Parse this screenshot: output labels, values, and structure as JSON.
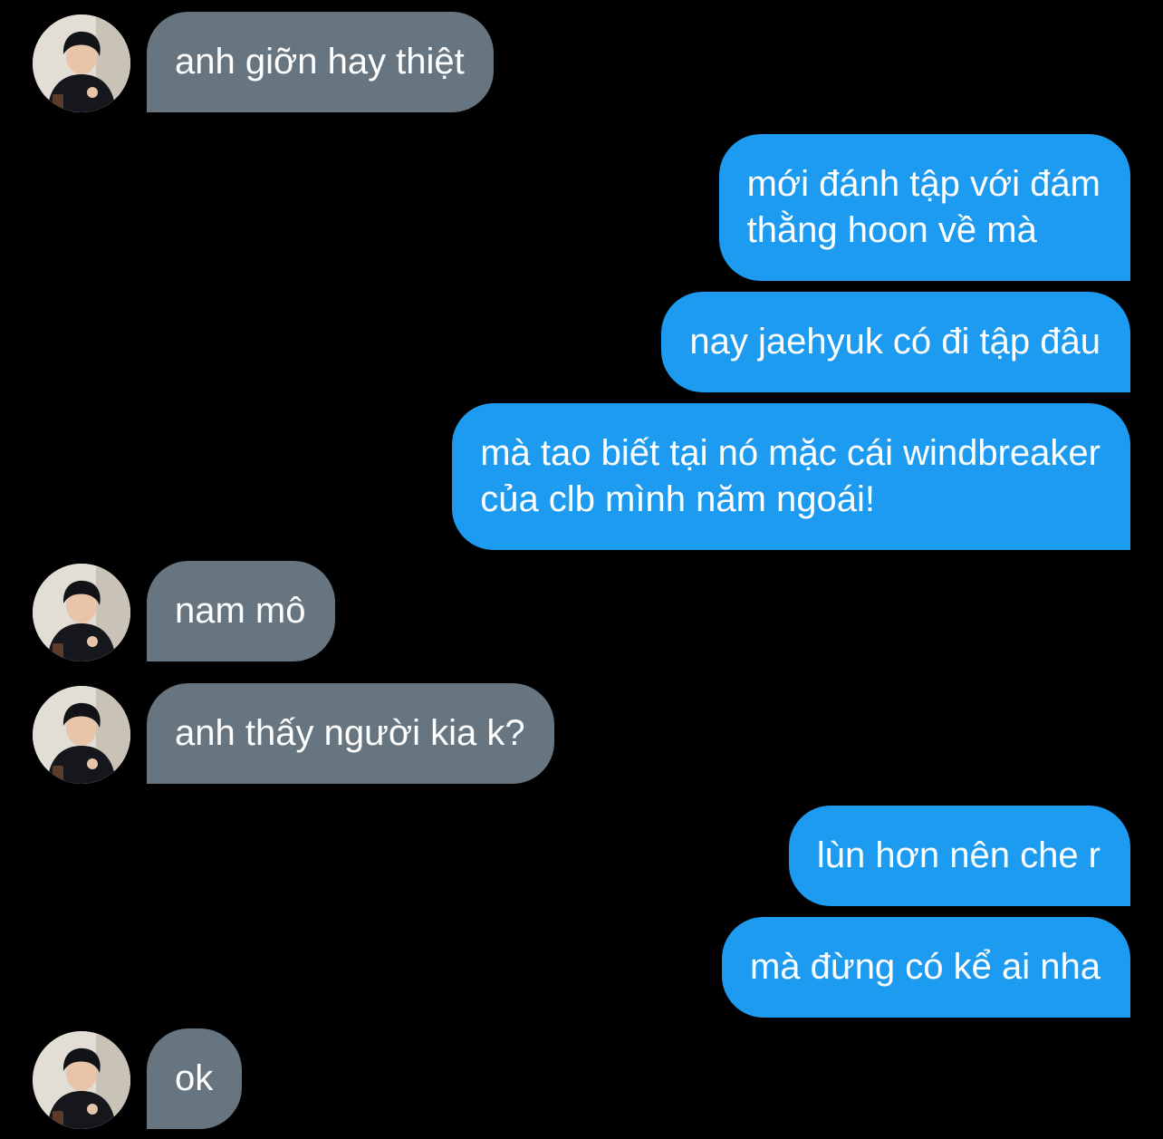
{
  "colors": {
    "background": "#000000",
    "incoming_bubble": "#66757f",
    "outgoing_bubble": "#1d9bf0",
    "text": "#ffffff"
  },
  "avatar": {
    "icon": "profile-photo-avatar"
  },
  "messages": [
    {
      "side": "incoming",
      "lines": [
        "anh giỡn hay thiệt"
      ]
    },
    {
      "side": "outgoing",
      "lines": [
        "mới đánh tập với đám",
        "thằng hoon về mà"
      ]
    },
    {
      "side": "outgoing",
      "lines": [
        "nay jaehyuk có đi tập đâu"
      ]
    },
    {
      "side": "outgoing",
      "lines": [
        "mà tao biết tại nó mặc cái windbreaker",
        "của clb mình năm ngoái!"
      ]
    },
    {
      "side": "incoming",
      "lines": [
        "nam mô"
      ]
    },
    {
      "side": "incoming",
      "lines": [
        "anh thấy người kia k?"
      ]
    },
    {
      "side": "outgoing",
      "lines": [
        "lùn hơn nên che r"
      ]
    },
    {
      "side": "outgoing",
      "lines": [
        "mà đừng có kể ai nha"
      ]
    },
    {
      "side": "incoming",
      "lines": [
        "ok"
      ]
    }
  ]
}
